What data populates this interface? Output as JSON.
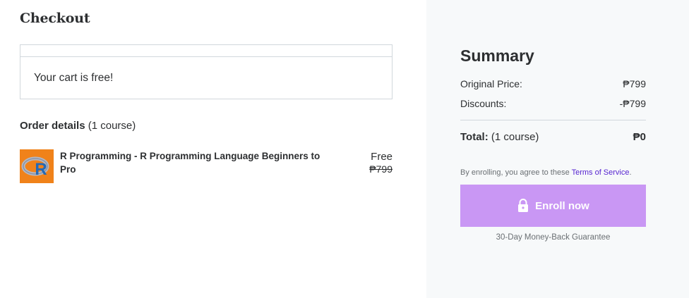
{
  "checkout": {
    "title": "Checkout",
    "cart_message": "Your cart is free!"
  },
  "order": {
    "heading": "Order details",
    "count": "(1 course)",
    "course": {
      "title": "R Programming - R Programming Language Beginners to Pro",
      "price": "Free",
      "original_price": "₱799",
      "thumbnail_icon": "r-logo-icon"
    }
  },
  "summary": {
    "title": "Summary",
    "original_label": "Original Price:",
    "original_value": "₱799",
    "discounts_label": "Discounts:",
    "discounts_value": "-₱799",
    "total_label": "Total:",
    "total_count": "(1 course)",
    "total_value": "₱0",
    "terms_prefix": "By enrolling, you agree to these ",
    "terms_link": "Terms of Service",
    "terms_suffix": ".",
    "enroll_label": "Enroll now",
    "guarantee": "30-Day Money-Back Guarantee"
  },
  "colors": {
    "enroll_button": "#c997f4",
    "link": "#5624d0",
    "summary_bg": "#f7f9fa"
  }
}
